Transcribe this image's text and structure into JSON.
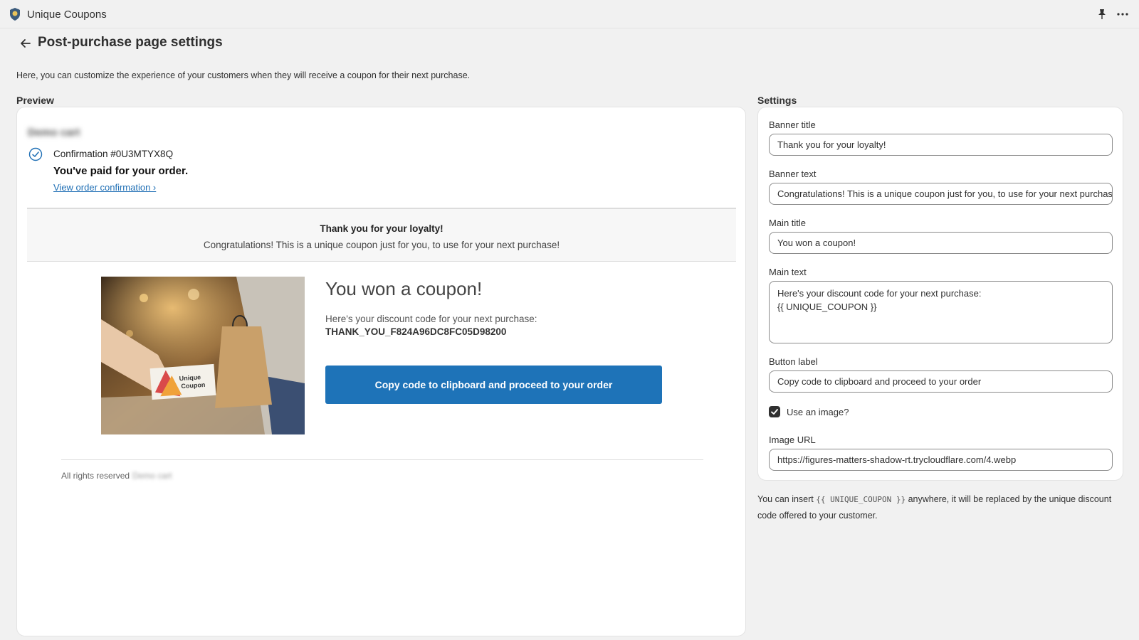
{
  "app": {
    "name": "Unique Coupons"
  },
  "header": {
    "title": "Post-purchase page settings"
  },
  "description": "Here, you can customize the experience of your customers when they will receive a coupon for their next purchase.",
  "preview": {
    "label": "Preview",
    "shop_name": "Demo cart",
    "confirmation": "Confirmation #0U3MTYX8Q",
    "paid_message": "You've paid for your order.",
    "view_link": "View order confirmation ›",
    "banner": {
      "title": "Thank you for your loyalty!",
      "text": "Congratulations! This is a unique coupon just for you, to use for your next purchase!"
    },
    "image": {
      "label_line1": "Unique",
      "label_line2": "Coupon"
    },
    "main_title": "You won a coupon!",
    "main_text": "Here's your discount code for your next purchase:",
    "coupon_code": "THANK_YOU_F824A96DC8FC05D98200",
    "button_label": "Copy code to clipboard and proceed to your order",
    "footer": {
      "text": "All rights reserved",
      "shop": "Demo cart"
    }
  },
  "settings": {
    "label": "Settings",
    "banner_title": {
      "label": "Banner title",
      "value": "Thank you for your loyalty!"
    },
    "banner_text": {
      "label": "Banner text",
      "value": "Congratulations! This is a unique coupon just for you, to use for your next purchase!"
    },
    "main_title": {
      "label": "Main title",
      "value": "You won a coupon!"
    },
    "main_text": {
      "label": "Main text",
      "value": "Here's your discount code for your next purchase:\n{{ UNIQUE_COUPON }}"
    },
    "button_label": {
      "label": "Button label",
      "value": "Copy code to clipboard and proceed to your order"
    },
    "use_image": {
      "label": "Use an image?",
      "checked": true
    },
    "image_url": {
      "label": "Image URL",
      "value": "https://figures-matters-shadow-rt.trycloudflare.com/4.webp"
    },
    "help": {
      "prefix": "You can insert",
      "code": "{{ UNIQUE_COUPON }}",
      "suffix": "anywhere, it will be replaced by the unique discount code offered to your customer."
    }
  },
  "colors": {
    "primary_button": "#1e73b8",
    "link": "#1f6fb5",
    "background": "#f1f1f1"
  }
}
